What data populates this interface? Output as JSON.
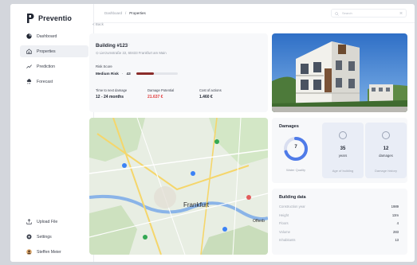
{
  "app": {
    "name": "Preventio"
  },
  "sidebar": {
    "items": [
      {
        "label": "Dashboard",
        "icon": "pie-chart-icon"
      },
      {
        "label": "Properties",
        "icon": "house-icon",
        "active": true
      },
      {
        "label": "Prediction",
        "icon": "trend-icon"
      },
      {
        "label": "Forecast",
        "icon": "cloud-rain-icon"
      }
    ],
    "bottom": [
      {
        "label": "Upload File",
        "icon": "upload-icon"
      },
      {
        "label": "Settings",
        "icon": "gear-icon"
      },
      {
        "label": "Steffen Meier",
        "icon": "avatar"
      }
    ]
  },
  "breadcrumb": {
    "parent": "Dashboard",
    "separator": "/",
    "current": "Properties"
  },
  "search": {
    "placeholder": "Search",
    "shortcut": "⌘"
  },
  "back_label": "< Back",
  "building": {
    "title": "Building #123",
    "address": "Lierzumstraße 22, 60433 Frankfurt am Main",
    "risk_label": "Risk Score",
    "risk_level": "Medium Risk",
    "risk_value": "43",
    "risk_fraction": 0.43,
    "stats": [
      {
        "label": "Time to next damage",
        "value": "12 - 24 months",
        "highlight": false
      },
      {
        "label": "Damage Potential",
        "value": "21.637 €",
        "highlight": true
      },
      {
        "label": "Cost of actions",
        "value": "1.460 €",
        "highlight": false
      }
    ]
  },
  "map": {
    "city_label": "Frankfurt",
    "offenbach_label": "Offenb"
  },
  "damages": {
    "title": "Damages",
    "water_quality_value": "7",
    "water_quality_label": "Water Quality",
    "water_quality_fraction": 0.7,
    "age": {
      "value": "35",
      "unit": "years",
      "label": "Age of building"
    },
    "history": {
      "value": "12",
      "unit": "damages",
      "label": "Damage history"
    }
  },
  "building_data": {
    "title": "Building data",
    "rows": [
      {
        "label": "Construction year",
        "value": "1989"
      },
      {
        "label": "Height",
        "value": "13m"
      },
      {
        "label": "Floors",
        "value": "4"
      },
      {
        "label": "Volume",
        "value": "283"
      },
      {
        "label": "Inhabitants",
        "value": "13"
      }
    ]
  },
  "colors": {
    "accent": "#3b82f6",
    "danger": "#e23b3b",
    "risk_bar": "#8a2c2a"
  }
}
